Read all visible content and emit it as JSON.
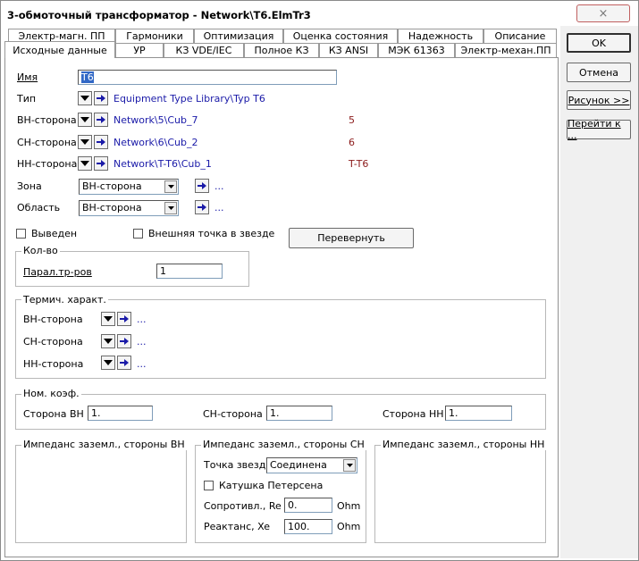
{
  "window": {
    "title": "3-обмоточный трансформатор - Network\\T6.ElmTr3",
    "close_glyph": "×"
  },
  "tabs_row1": [
    {
      "label": "Электр-магн. ПП"
    },
    {
      "label": "Гармоники"
    },
    {
      "label": "Оптимизация"
    },
    {
      "label": "Оценка состояния"
    },
    {
      "label": "Надежность"
    },
    {
      "label": "Описание"
    }
  ],
  "tabs_row2": [
    {
      "label": "Исходные данные"
    },
    {
      "label": "УР"
    },
    {
      "label": "КЗ VDE/IEC"
    },
    {
      "label": "Полное КЗ"
    },
    {
      "label": "КЗ ANSI"
    },
    {
      "label": "МЭК 61363"
    },
    {
      "label": "Электр-механ.ПП"
    }
  ],
  "right_buttons": {
    "ok": "OK",
    "cancel": "Отмена",
    "figure": "Рисунок >>",
    "goto": "Перейти к ..."
  },
  "form": {
    "name_label": "Имя",
    "name_value": "T6",
    "type_label": "Тип",
    "type_value": "Equipment Type Library\\Typ T6",
    "hv_label": "ВН-сторона",
    "hv_value": "Network\\5\\Cub_7",
    "hv_node": "5",
    "mv_label": "СН-сторона",
    "mv_value": "Network\\6\\Cub_2",
    "mv_node": "6",
    "lv_label": "НН-сторона",
    "lv_value": "Network\\T-T6\\Cub_1",
    "lv_node": "T-T6",
    "zone_label": "Зона",
    "zone_value": "ВН-сторона",
    "zone_dots": "...",
    "area_label": "Область",
    "area_value": "ВН-сторона",
    "area_dots": "...",
    "out_of_service_label": "Выведен",
    "star_point_label": "Внешняя точка в звезде",
    "flip_button": "Перевернуть"
  },
  "qty_group": {
    "title": "Кол-во",
    "parallel_label": "Парал.тр-ров",
    "parallel_value": "1"
  },
  "thermal_group": {
    "title": "Термич. характ.",
    "hv_label": "ВН-сторона",
    "hv_dots": "...",
    "mv_label": "СН-сторона",
    "mv_dots": "...",
    "lv_label": "НН-сторона",
    "lv_dots": "..."
  },
  "ratio_group": {
    "title": "Ном. коэф.",
    "hv_label": "Сторона ВН",
    "hv_value": "1.",
    "mv_label": "СН-сторона",
    "mv_value": "1.",
    "lv_label": "Сторона НН",
    "lv_value": "1."
  },
  "ground_hv": {
    "title": "Импеданс заземл., стороны ВН"
  },
  "ground_mv": {
    "title": "Импеданс заземл., стороны СН",
    "star_label": "Точка звезды",
    "star_value": "Соединена",
    "petersen_label": "Катушка Петерсена",
    "re_label": "Сопротивл., Re",
    "re_value": "0.",
    "re_unit": "Ohm",
    "xe_label": "Реактанс, Xe",
    "xe_value": "100.",
    "xe_unit": "Ohm"
  },
  "ground_lv": {
    "title": "Импеданс заземл., стороны НН"
  },
  "colors": {
    "link": "#1a1aa8",
    "node": "#8b1a1a",
    "accent_selection": "#3168c6"
  }
}
